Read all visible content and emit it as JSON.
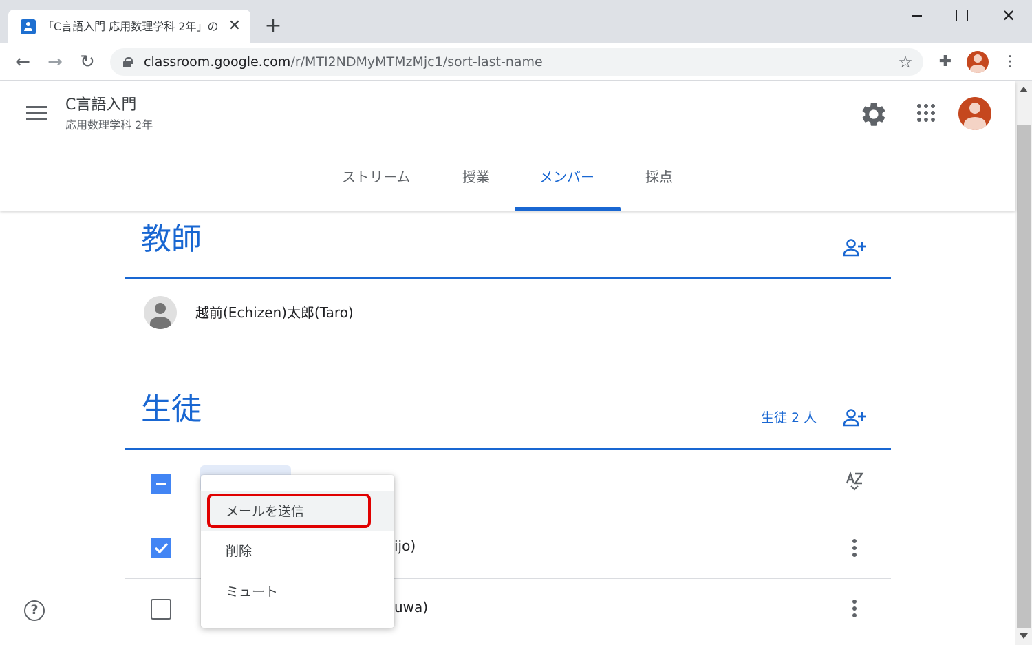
{
  "browser": {
    "tab_title": "「C言語入門 応用数理学科 2年」の",
    "tab_close": "✕",
    "new_tab": "+",
    "window_close": "✕",
    "back": "←",
    "forward": "→",
    "reload": "↻",
    "url_host": "classroom.google.com",
    "url_path": "/r/MTI2NDMyMTMzMjc1/sort-last-name",
    "star": "☆",
    "extensions": "✚",
    "menu": "⋮"
  },
  "header": {
    "class_title": "C言語入門",
    "class_subtitle": "応用数理学科 2年",
    "tabs": [
      {
        "label": "ストリーム"
      },
      {
        "label": "授業"
      },
      {
        "label": "メンバー"
      },
      {
        "label": "採点"
      }
    ],
    "active_tab": "メンバー"
  },
  "teachers": {
    "title": "教師",
    "list": [
      {
        "name": "越前(Echizen)太郎(Taro)"
      }
    ]
  },
  "students": {
    "title": "生徒",
    "count_label": "生徒 2 人",
    "rows": [
      {
        "name_visible": "ijo)",
        "checked": true
      },
      {
        "name_visible": "uwa)",
        "checked": false
      }
    ]
  },
  "actions_menu": {
    "items": [
      {
        "label": "メールを送信"
      },
      {
        "label": "削除"
      },
      {
        "label": "ミュート"
      }
    ],
    "hovered": "メールを送信"
  },
  "colors": {
    "accent": "#1967d2",
    "checkbox": "#4285f4",
    "highlight": "#e00000",
    "avatar": "#c5471e"
  },
  "help": "?"
}
